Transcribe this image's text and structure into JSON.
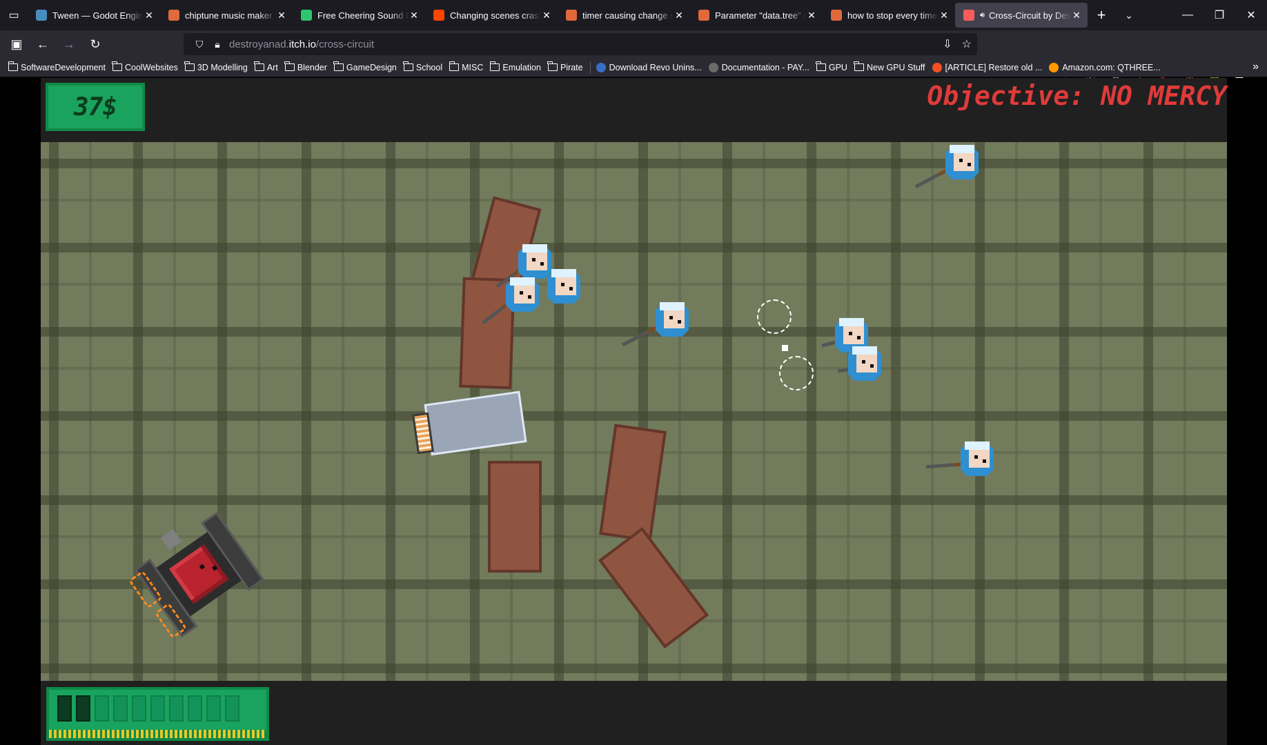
{
  "browser": {
    "tabs": [
      {
        "title": "Tween — Godot Engine (",
        "favicon": "godot-docs-icon",
        "color": "#478cbf",
        "active": false
      },
      {
        "title": "chiptune music maker at",
        "favicon": "brave-icon",
        "color": "#e06a3b",
        "active": false
      },
      {
        "title": "Free Cheering Sound Effe",
        "favicon": "pixabay-icon",
        "color": "#2ec66d",
        "active": false
      },
      {
        "title": "Changing scenes crashes",
        "favicon": "reddit-icon",
        "color": "#ff4500",
        "active": false
      },
      {
        "title": "timer causing change sce",
        "favicon": "brave-icon",
        "color": "#e06a3b",
        "active": false
      },
      {
        "title": "Parameter \"data.tree\" is n",
        "favicon": "brave-icon",
        "color": "#e06a3b",
        "active": false
      },
      {
        "title": "how to stop every timer c",
        "favicon": "brave-icon",
        "color": "#e06a3b",
        "active": false
      },
      {
        "title": "Cross-Circuit by Dest",
        "favicon": "itchio-icon",
        "color": "#fa5c5c",
        "active": true
      }
    ],
    "url": {
      "prefix": "destroyanad.",
      "domain": "itch.io",
      "path": "/cross-circuit"
    },
    "bookmarks": [
      {
        "label": "SoftwareDevelopment",
        "type": "folder"
      },
      {
        "label": "CoolWebsites",
        "type": "folder"
      },
      {
        "label": "3D Modelling",
        "type": "folder"
      },
      {
        "label": "Art",
        "type": "folder"
      },
      {
        "label": "Blender",
        "type": "folder"
      },
      {
        "label": "GameDesign",
        "type": "folder"
      },
      {
        "label": "School",
        "type": "folder"
      },
      {
        "label": "MISC",
        "type": "folder"
      },
      {
        "label": "Emulation",
        "type": "folder"
      },
      {
        "label": "Pirate",
        "type": "folder"
      },
      {
        "label": "Download Revo Unins...",
        "type": "site",
        "color": "#3a6ec8"
      },
      {
        "label": "Documentation - PAY...",
        "type": "site",
        "color": "#6b6b6b"
      },
      {
        "label": "GPU",
        "type": "folder"
      },
      {
        "label": "New GPU Stuff",
        "type": "folder"
      },
      {
        "label": "[ARTICLE] Restore old ...",
        "type": "site",
        "color": "#f25022"
      },
      {
        "label": "Amazon.com: QTHREE...",
        "type": "site",
        "color": "#ff9900"
      }
    ]
  },
  "game": {
    "money": "37$",
    "objective": "Objective: NO MERCY",
    "energy": {
      "filled": 2,
      "total": 10
    }
  }
}
